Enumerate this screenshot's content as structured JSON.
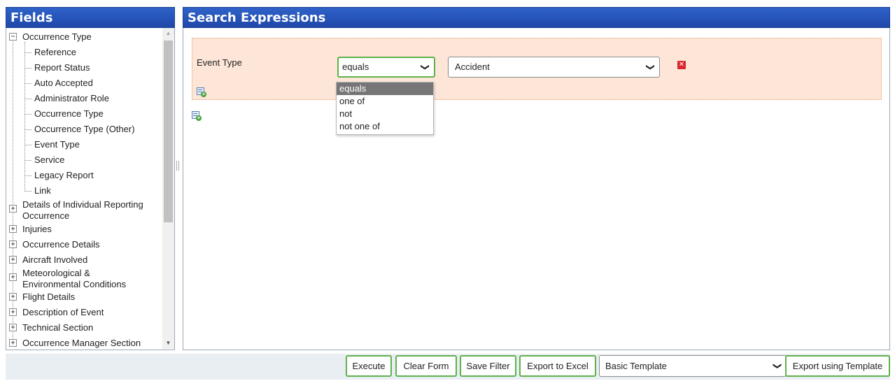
{
  "fields_panel": {
    "title": "Fields",
    "tree": [
      {
        "label": "Occurrence Type",
        "expanded": true,
        "level": 0
      },
      {
        "label": "Reference",
        "level": 1
      },
      {
        "label": "Report Status",
        "level": 1
      },
      {
        "label": "Auto Accepted",
        "level": 1
      },
      {
        "label": "Administrator Role",
        "level": 1
      },
      {
        "label": "Occurrence Type",
        "level": 1
      },
      {
        "label": "Occurrence Type (Other)",
        "level": 1
      },
      {
        "label": "Event Type",
        "level": 1
      },
      {
        "label": "Service",
        "level": 1
      },
      {
        "label": "Legacy Report",
        "level": 1
      },
      {
        "label": "Link",
        "level": 1
      },
      {
        "label": "Details of Individual Reporting Occurrence",
        "label_line1": "Details of Individual Reporting",
        "label_line2": "Occurrence",
        "expanded": false,
        "level": 0
      },
      {
        "label": "Injuries",
        "expanded": false,
        "level": 0
      },
      {
        "label": "Occurrence Details",
        "expanded": false,
        "level": 0
      },
      {
        "label": "Aircraft Involved",
        "expanded": false,
        "level": 0
      },
      {
        "label": "Meteorological & Environmental Conditions",
        "label_line1": "Meteorological &",
        "label_line2": "Environmental Conditions",
        "expanded": false,
        "level": 0
      },
      {
        "label": "Flight Details",
        "expanded": false,
        "level": 0
      },
      {
        "label": "Description of Event",
        "expanded": false,
        "level": 0
      },
      {
        "label": "Technical Section",
        "expanded": false,
        "level": 0
      },
      {
        "label": "Occurrence Manager Section",
        "expanded": false,
        "level": 0
      }
    ]
  },
  "search_panel": {
    "title": "Search Expressions",
    "expression": {
      "field_label": "Event Type",
      "operator": "equals",
      "value": "Accident"
    },
    "operator_options": [
      "equals",
      "one of",
      "not",
      "not one of"
    ],
    "selected_operator_option": "equals"
  },
  "footer": {
    "execute": "Execute",
    "clear_form": "Clear Form",
    "save_filter": "Save Filter",
    "export_excel": "Export to Excel",
    "template_select": "Basic Template",
    "export_template": "Export using Template"
  },
  "colors": {
    "header_blue": "#2f62c9",
    "expression_bg": "#fde6d8",
    "button_border_green": "#5fb14b",
    "delete_red": "#d9262b"
  }
}
